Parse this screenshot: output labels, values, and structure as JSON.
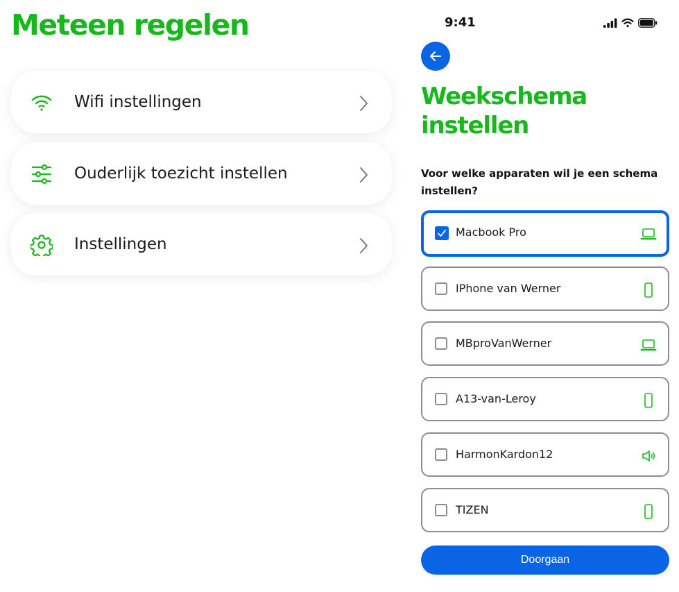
{
  "left_panel": {
    "title": "Meteen regelen",
    "menu": [
      {
        "label": "Wifi instellingen",
        "icon": "wifi-icon"
      },
      {
        "label": "Ouderlijk toezicht instellen",
        "icon": "sliders-icon"
      },
      {
        "label": "Instellingen",
        "icon": "gear-icon"
      }
    ]
  },
  "phone": {
    "status_bar": {
      "time": "9:41"
    },
    "title": "Weekschema instellen",
    "question": "Voor welke apparaten wil je een schema instellen?",
    "devices": [
      {
        "name": "Macbook Pro",
        "selected": true,
        "icon": "laptop-icon"
      },
      {
        "name": "IPhone van Werner",
        "selected": false,
        "icon": "phone-icon"
      },
      {
        "name": "MBproVanWerner",
        "selected": false,
        "icon": "laptop-icon"
      },
      {
        "name": "A13-van-Leroy",
        "selected": false,
        "icon": "phone-icon"
      },
      {
        "name": "HarmonKardon12",
        "selected": false,
        "icon": "speaker-icon"
      },
      {
        "name": "TIZEN",
        "selected": false,
        "icon": "phone-icon"
      }
    ],
    "continue_label": "Doorgaan"
  },
  "colors": {
    "brand_green": "#18b81d",
    "primary_blue": "#0a64e6",
    "border_gray": "#8d8d8d"
  }
}
